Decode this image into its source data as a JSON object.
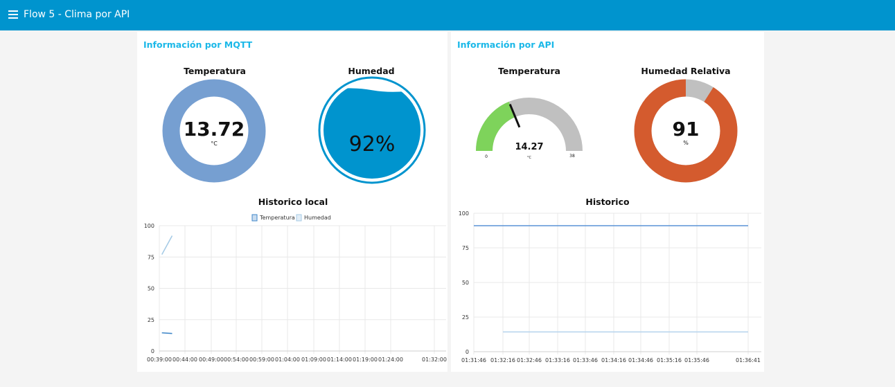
{
  "header": {
    "title": "Flow 5 - Clima por API",
    "menu_icon": "menu-icon"
  },
  "groups": {
    "mqtt": {
      "title": "Información por MQTT",
      "temperature": {
        "title": "Temperatura",
        "value": "13.72",
        "unit": "°C",
        "color": "#769fd1",
        "fraction": 1.0
      },
      "humidity": {
        "title": "Humedad",
        "value": "92%",
        "level_percent": 92,
        "color": "#0094ce"
      },
      "history": {
        "title": "Historico local"
      }
    },
    "api": {
      "title": "Información por API",
      "temperature": {
        "title": "Temperatura",
        "value": "14.27",
        "unit": "°C",
        "min": "0",
        "max": "38",
        "value_num": 14.27,
        "min_num": 0,
        "max_num": 38,
        "fill_color": "#7ed35b",
        "track_color": "#c0c0c0"
      },
      "humidity": {
        "title": "Humedad Relativa",
        "value": "91",
        "unit": "%",
        "value_num": 91,
        "max_num": 100,
        "fill_color": "#d45b2e",
        "track_color": "#c0c0c0"
      },
      "history": {
        "title": "Historico"
      }
    }
  },
  "chart_data": [
    {
      "type": "line",
      "title": "Historico local",
      "legend": [
        "Temperatura",
        "Humedad"
      ],
      "legend_position": "top",
      "x_ticks": [
        "00:39:00",
        "00:44:00",
        "00:49:00",
        "00:54:00",
        "00:59:00",
        "01:04:00",
        "01:09:00",
        "01:14:00",
        "01:19:00",
        "01:24:00",
        "01:32:00"
      ],
      "y_ticks": [
        "0",
        "25",
        "50",
        "75",
        "100"
      ],
      "ylim": [
        0,
        100
      ],
      "grid": true,
      "series": [
        {
          "name": "Temperatura",
          "color": "#3e86c8",
          "points": [
            {
              "x": "00:39:30",
              "y": 14.5
            },
            {
              "x": "00:41:30",
              "y": 14.0
            }
          ]
        },
        {
          "name": "Humedad",
          "color": "#a6cbe6",
          "points": [
            {
              "x": "00:39:30",
              "y": 77
            },
            {
              "x": "00:41:30",
              "y": 92
            }
          ]
        }
      ]
    },
    {
      "type": "line",
      "title": "Historico",
      "x_ticks": [
        "01:31:46",
        "01:32:16",
        "01:32:46",
        "01:33:16",
        "01:33:46",
        "01:34:16",
        "01:34:46",
        "01:35:16",
        "01:35:46",
        "01:36:41"
      ],
      "y_ticks": [
        "0",
        "25",
        "50",
        "75",
        "100"
      ],
      "ylim": [
        0,
        100
      ],
      "grid": true,
      "series": [
        {
          "color": "#5a93d6",
          "points": [
            {
              "x": "01:31:46",
              "y": 91
            },
            {
              "x": "01:36:41",
              "y": 91
            }
          ]
        },
        {
          "color": "#b9d5ee",
          "points": [
            {
              "x": "01:32:16",
              "y": 14.3
            },
            {
              "x": "01:36:41",
              "y": 14.3
            }
          ]
        }
      ]
    }
  ]
}
